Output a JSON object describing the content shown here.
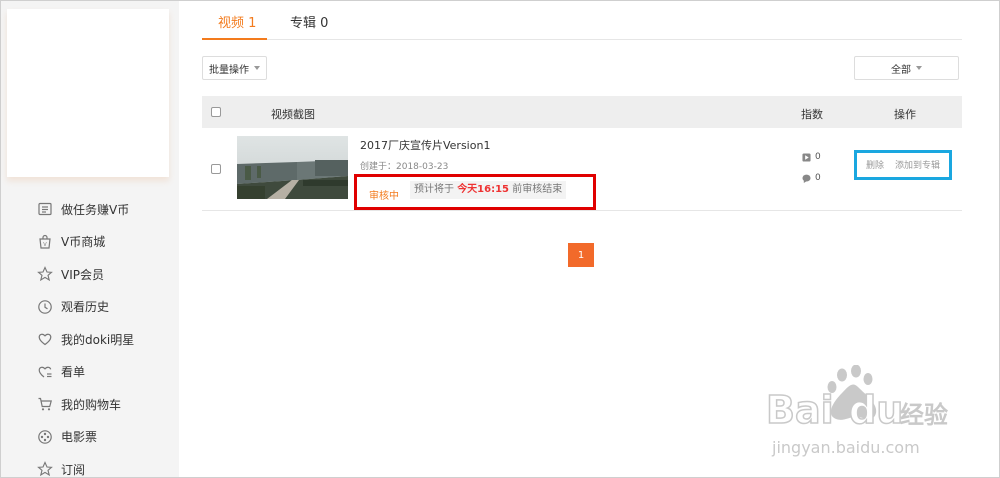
{
  "sidebar": {
    "items": [
      {
        "label": "做任务赚V币",
        "icon": "task-list-icon"
      },
      {
        "label": "V币商城",
        "icon": "shopping-bag-icon"
      },
      {
        "label": "VIP会员",
        "icon": "star-outline-icon"
      },
      {
        "label": "观看历史",
        "icon": "clock-icon"
      },
      {
        "label": "我的doki明星",
        "icon": "heart-outline-icon"
      },
      {
        "label": "看单",
        "icon": "heart-list-icon"
      },
      {
        "label": "我的购物车",
        "icon": "cart-icon"
      },
      {
        "label": "电影票",
        "icon": "film-reel-icon"
      },
      {
        "label": "订阅",
        "icon": "star-icon"
      }
    ]
  },
  "tabs": [
    {
      "label": "视频 1",
      "active": true
    },
    {
      "label": "专辑 0",
      "active": false
    }
  ],
  "toolbar": {
    "batch_label": "批量操作",
    "filter_label": "全部"
  },
  "table": {
    "headers": {
      "screenshot": "视频截图",
      "index": "指数",
      "actions": "操作"
    },
    "rows": [
      {
        "title": "2017厂庆宣传片Version1",
        "created": "创建于：2018-03-23",
        "status": "审核中",
        "note_prefix": "预计将于",
        "note_time": "今天16:15",
        "note_suffix": "前审核结束",
        "plays": "0",
        "comments": "0",
        "actions": {
          "delete": "删除",
          "add_to_album": "添加到专辑"
        }
      }
    ]
  },
  "pagination": {
    "current": "1"
  },
  "watermark": {
    "brand": "Bai du 经验",
    "url": "jingyan.baidu.com"
  },
  "colors": {
    "accent": "#f37b1d",
    "page_button": "#f26a2a",
    "highlight_red": "#e00000",
    "highlight_blue": "#1aa7e0"
  }
}
